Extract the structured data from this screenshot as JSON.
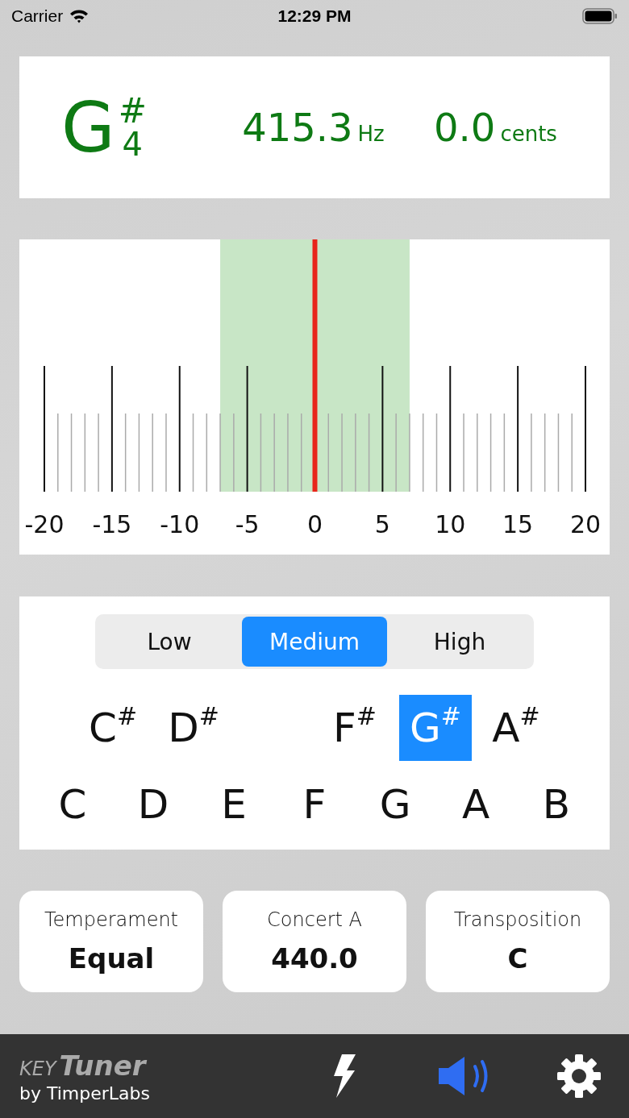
{
  "status_bar": {
    "carrier": "Carrier",
    "time": "12:29 PM"
  },
  "reading": {
    "note": "G",
    "accidental": "#",
    "octave": "4",
    "frequency": "415.3",
    "frequency_unit": "Hz",
    "cents": "0.0",
    "cents_unit": "cents"
  },
  "meter": {
    "scale": [
      "-20",
      "-15",
      "-10",
      "-5",
      "0",
      "5",
      "10",
      "15",
      "20"
    ]
  },
  "sensitivity": [
    {
      "label": "Low",
      "selected": false
    },
    {
      "label": "Medium",
      "selected": true
    },
    {
      "label": "High",
      "selected": false
    }
  ],
  "sharp_keys": [
    {
      "kind": "key",
      "label": "C$^{#}$",
      "selected": false
    },
    {
      "kind": "key",
      "label": "D$^{#}$",
      "selected": false
    },
    {
      "kind": "spacer"
    },
    {
      "kind": "key",
      "label": "F$^{#}$",
      "selected": false
    },
    {
      "kind": "key",
      "label": "G$^{#}$",
      "selected": true
    },
    {
      "kind": "key",
      "label": "A$^{#}$",
      "selected": false
    }
  ],
  "natural_keys": [
    {
      "label": "C",
      "selected": false
    },
    {
      "label": "D",
      "selected": false
    },
    {
      "label": "E",
      "selected": false
    },
    {
      "label": "F",
      "selected": false
    },
    {
      "label": "G",
      "selected": false
    },
    {
      "label": "A",
      "selected": false
    },
    {
      "label": "B",
      "selected": false
    }
  ],
  "settings": [
    {
      "label": "Temperament",
      "value": "Equal"
    },
    {
      "label": "Concert A",
      "value": "440.0"
    },
    {
      "label": "Transposition",
      "value": "C"
    }
  ],
  "toolbar": {
    "logo_prefix": "KEY",
    "logo_name": "Tuner",
    "byline": "by TimperLabs",
    "sound_on": true
  }
}
